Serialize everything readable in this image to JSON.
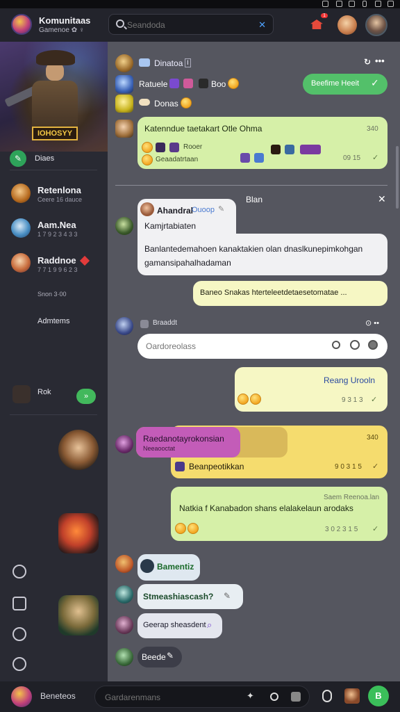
{
  "header": {
    "app_title": "Komunitaas",
    "app_subtitle": "Gamenoe ✿ ♀",
    "search_placeholder": "Seandoda",
    "notification_count": "1"
  },
  "sidebar": {
    "hero_badge": "IOHOSYY",
    "hero_label": "Diaes",
    "contacts": [
      {
        "name": "Retenlona",
        "sub": "Ceere 16 dauce"
      },
      {
        "name": "Aam.Nea",
        "sub": "1 7 9 2 3 4 3 3"
      },
      {
        "name": "Raddnoe",
        "sub": "7 7 1 9 9 6 2 3"
      }
    ],
    "note": "Snon 3·00",
    "section": "Admtems",
    "rock": "Rok",
    "rock_btn": "»"
  },
  "chat": {
    "top_row": {
      "text": "Dinatoa",
      "tag": "Ⅰ"
    },
    "row2": {
      "text": "Ratuele",
      "extra": "Boo"
    },
    "row3": {
      "text": "Donas"
    },
    "bookmark_label": "Beefime Heeit",
    "msg1": {
      "text": "Katenndue taetakart Otle Ohma",
      "count": "340",
      "sub1": "Rooer",
      "sub2": "Geaadatrtaan",
      "time": "09 15"
    },
    "divider_label": "Blan",
    "msg2": {
      "sender": "Ahandral",
      "sender_tag": "Ouoop",
      "sub": "Kamjrtabiaten",
      "text": "Banlantedemahoen kanaktakien olan dnaslkunepimkohgan gamansipahalhadaman"
    },
    "msg3": {
      "text": "Baneo  Snakas  hterteleetdetaesetomatae ..."
    },
    "row_input": {
      "label": "Braaddt",
      "placeholder": "Oardoreolass"
    },
    "msg4": {
      "text": "Reang Urooln",
      "time": "9 3 1 3"
    },
    "msg5": {
      "purple_text": "Raedanotayrokonsian",
      "purple_sub": "Neeaooctat",
      "count": "340",
      "sub": "Beanpeotikkan",
      "time": "9 0 3 1 5"
    },
    "msg6": {
      "header": "Saem Reenoa.lan",
      "text": "Natkia  f  Kanabadon  shans  elalakelaun  arodaks",
      "time": "3 0  2 3 1 5"
    },
    "small1": "Bamentiz",
    "small2": "Stmeashiascash?",
    "small3": "Geerap  sheasdent",
    "small4": "Beede"
  },
  "bottom": {
    "label": "Beneteos",
    "placeholder": "Gardarenmans"
  }
}
